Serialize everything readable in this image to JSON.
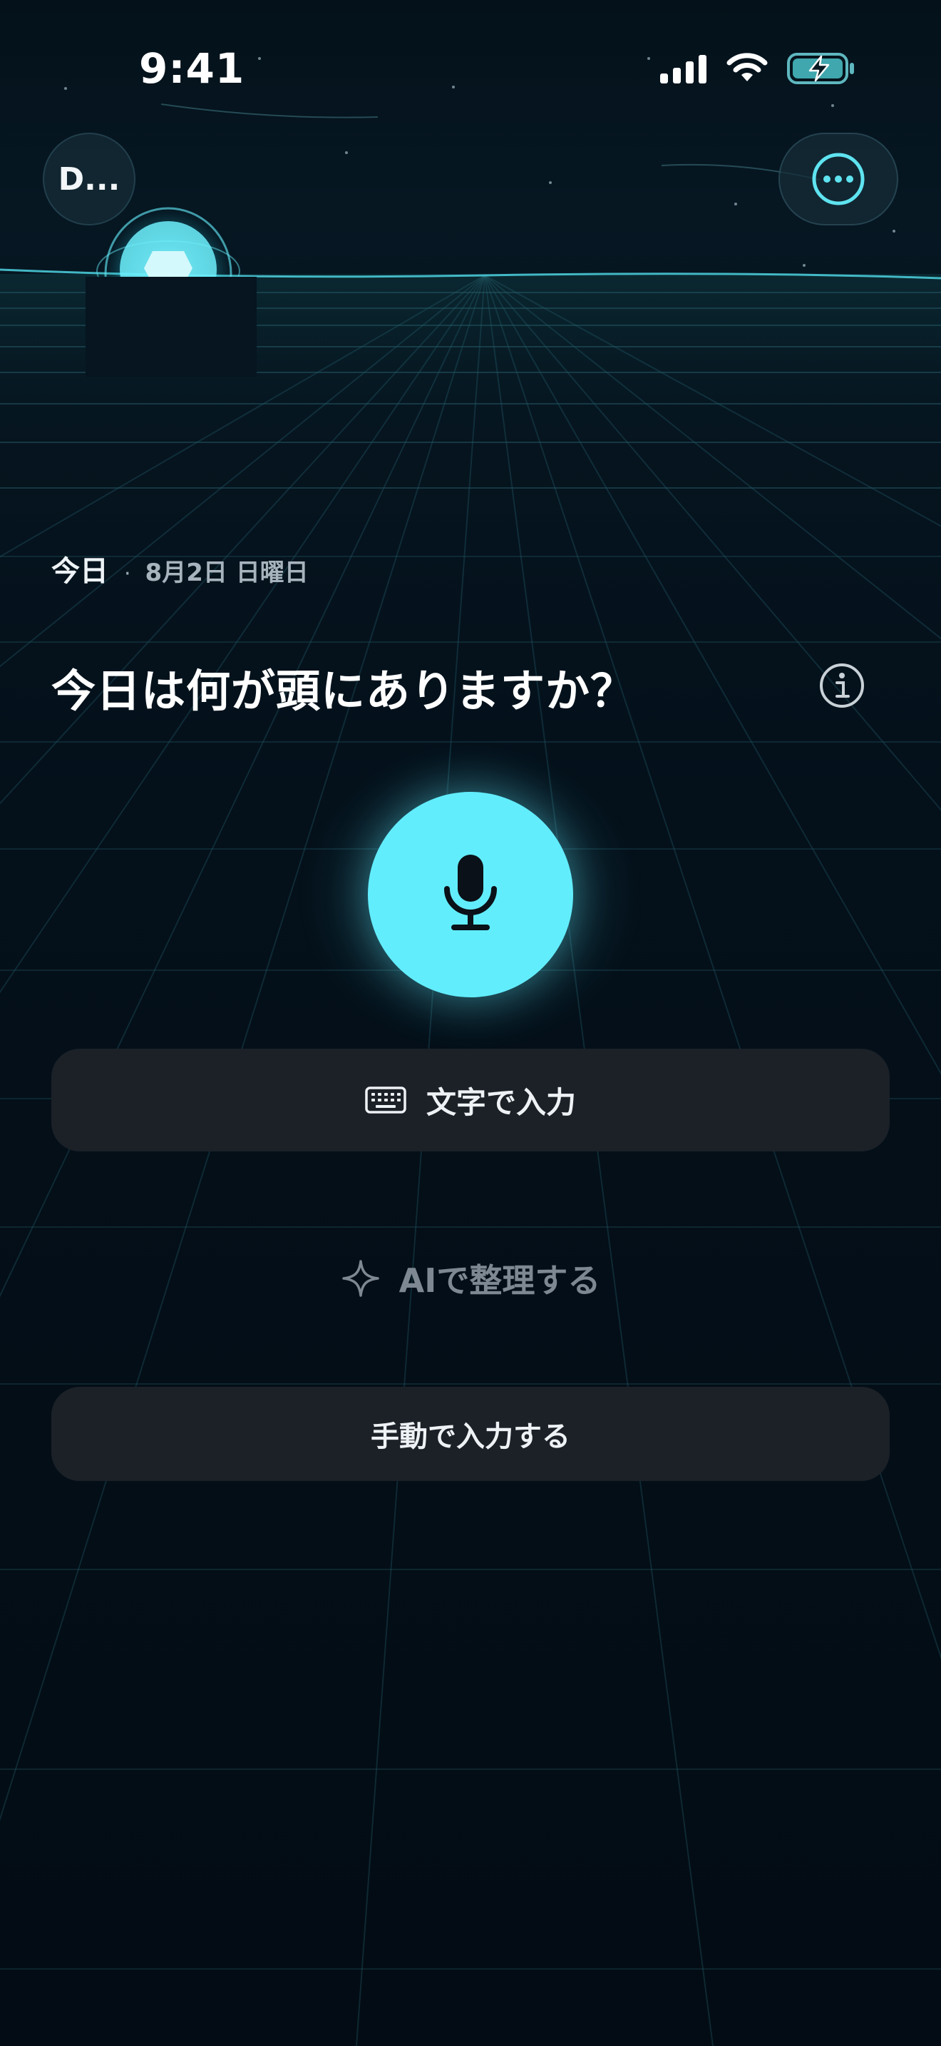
{
  "status_bar": {
    "time": "9:41",
    "icons": [
      "cellular-signal-icon",
      "wifi-icon",
      "battery-charging-icon"
    ]
  },
  "header": {
    "account_label": "D...",
    "more_icon": "ellipsis-circle-icon"
  },
  "date": {
    "today": "今日",
    "separator": "·",
    "full": "8月2日 日曜日"
  },
  "prompt": {
    "title": "今日は何が頭にありますか？",
    "info_icon": "info-circle-icon"
  },
  "actions": {
    "mic_icon": "microphone-icon",
    "keyboard_icon": "keyboard-icon",
    "keyboard_label": "文字で入力",
    "ai_icon": "sparkle-icon",
    "ai_label": "AIで整理する",
    "manual_label": "手動で入力する"
  },
  "colors": {
    "accent": "#62edfd",
    "background": "#050d16",
    "button_surface": "#1c2128",
    "muted_text": "#7e8892"
  }
}
